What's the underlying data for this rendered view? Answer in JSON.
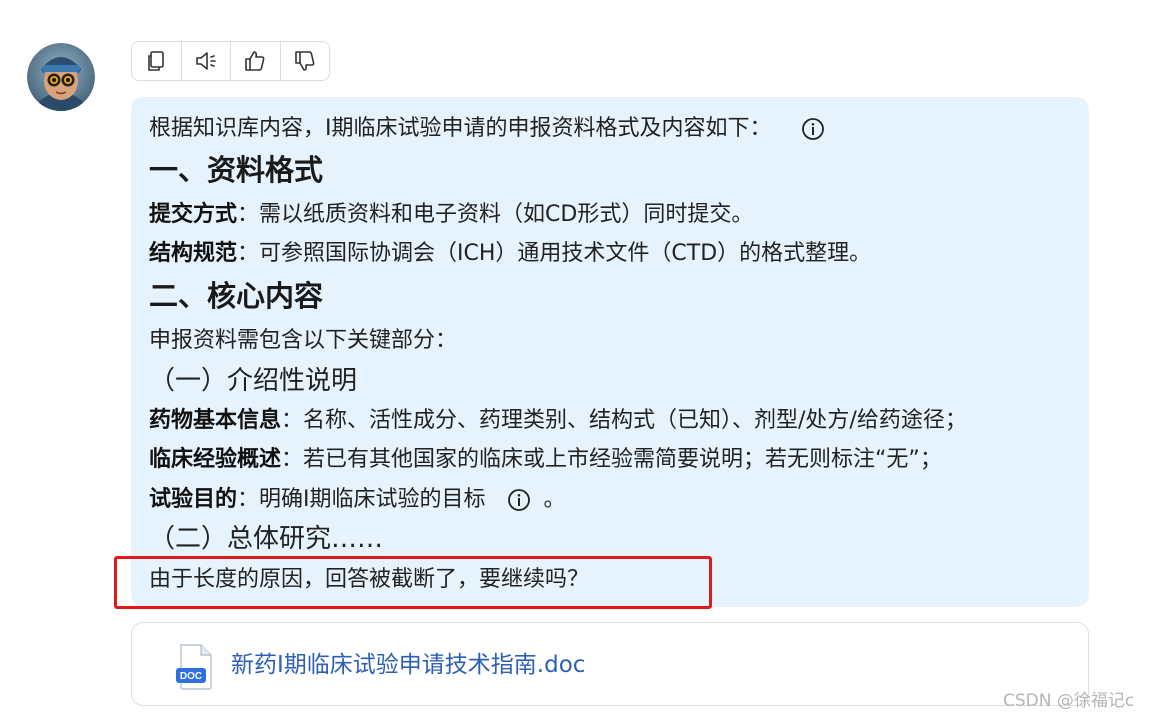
{
  "toolbar": {
    "buttons": [
      "copy-icon",
      "speaker-icon",
      "thumbs-up-icon",
      "thumbs-down-icon"
    ]
  },
  "answer": {
    "intro": "根据知识库内容，I期临床试验申请的申报资料格式及内容如下：",
    "heading1": "一、资料格式",
    "item1_label": "提交方式",
    "item1_text": "：需以纸质资料和电子资料（如CD形式）同时提交。",
    "item2_label": "结构规范",
    "item2_text": "：可参照国际协调会（ICH）通用技术文件（CTD）的格式整理。",
    "heading2": "二、核心内容",
    "content_intro": "申报资料需包含以下关键部分：",
    "sub1": "（一）介绍性说明",
    "item3_label": "药物基本信息",
    "item3_text": "：名称、活性成分、药理类别、结构式（已知）、剂型/处方/给药途径；",
    "item4_label": "临床经验概述",
    "item4_text": "：若已有其他国家的临床或上市经验需简要说明；若无则标注“无”；",
    "item5_label": "试验目的",
    "item5_text": "：明确I期临床试验的目标",
    "item5_end": "。",
    "sub2": "（二）总体研究……",
    "truncation_notice": "由于长度的原因，回答被截断了，要继续吗？"
  },
  "attachment": {
    "badge": "DOC",
    "title": "新药I期临床试验申请技术指南.doc"
  },
  "watermark": "CSDN @徐福记c",
  "colors": {
    "bubble_bg": "#e6f3fd",
    "highlight_box": "#e0191a",
    "link": "#2d5fb5",
    "doc_badge": "#2f6fe0"
  }
}
